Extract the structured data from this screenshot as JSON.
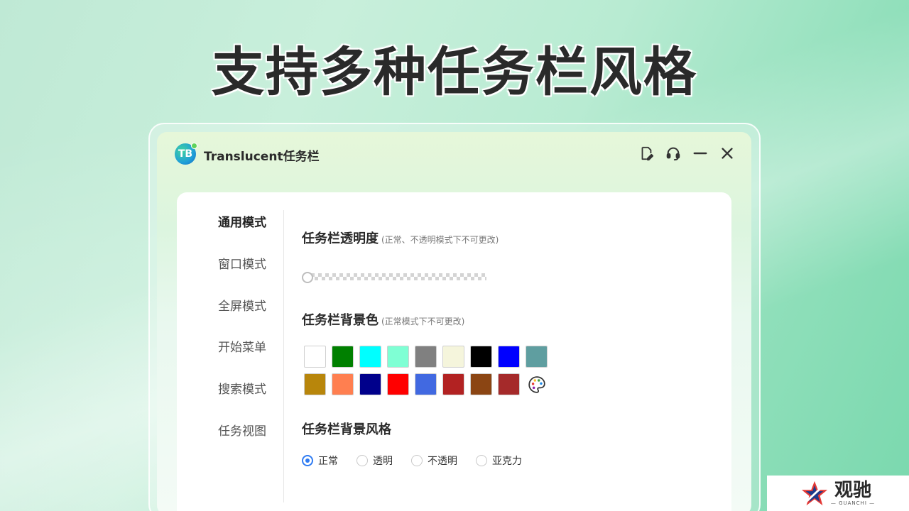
{
  "headline": "支持多种任务栏风格",
  "window": {
    "title": "Translucent任务栏",
    "logo_letters": "TB",
    "icons": [
      "edit-note-icon",
      "headset-icon",
      "minimize-icon",
      "close-icon"
    ]
  },
  "sidebar": {
    "items": [
      {
        "label": "通用模式",
        "active": true
      },
      {
        "label": "窗口模式",
        "active": false
      },
      {
        "label": "全屏模式",
        "active": false
      },
      {
        "label": "开始菜单",
        "active": false
      },
      {
        "label": "搜索模式",
        "active": false
      },
      {
        "label": "任务视图",
        "active": false
      }
    ]
  },
  "transparency": {
    "title": "任务栏透明度",
    "note": "(正常、不透明模式下不可更改)",
    "slider_value": 0
  },
  "bg_color": {
    "title": "任务栏背景色",
    "note": "(正常模式下不可更改)",
    "colors_row1": [
      "#ffffff",
      "#008000",
      "#00ffff",
      "#7fffd4",
      "#808080",
      "#f5f5dc",
      "#000000",
      "#0000ff",
      "#5f9ea0"
    ],
    "colors_row2": [
      "#b8860b",
      "#ff7f50",
      "#00008b",
      "#ff0000",
      "#4169e1",
      "#b22222",
      "#8b4513",
      "#a52a2a"
    ],
    "palette_icon": "palette-icon"
  },
  "bg_style": {
    "title": "任务栏背景风格",
    "options": [
      {
        "label": "正常",
        "checked": true
      },
      {
        "label": "透明",
        "checked": false
      },
      {
        "label": "不透明",
        "checked": false
      },
      {
        "label": "亚克力",
        "checked": false
      }
    ]
  },
  "brand": {
    "name": "观驰",
    "sub": "— GUANCHI —"
  },
  "colors": {
    "accent": "#2f7bf2",
    "text": "#2a2a2a"
  }
}
